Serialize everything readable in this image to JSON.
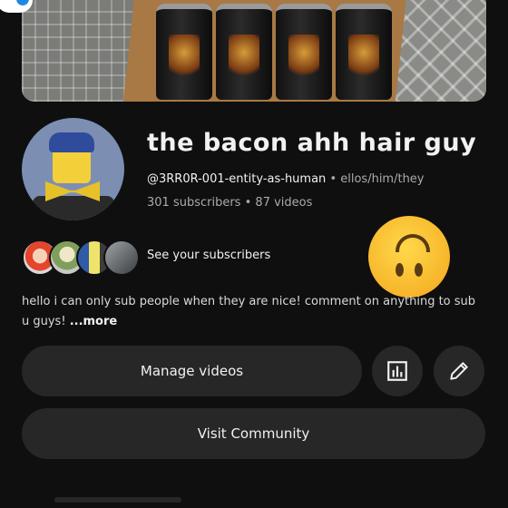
{
  "channel": {
    "name": "the bacon ahh hair guy",
    "handle": "@3RR0R-001-entity-as-human",
    "pronouns": "ellos/him/they",
    "separator": "•",
    "subscribers": "301 subscribers",
    "videos": "87 videos"
  },
  "subscribers_row": {
    "label": "See your subscribers"
  },
  "description": {
    "text": "hello i can only sub people when they are nice! comment on anything to sub u guys! ",
    "more": "...more"
  },
  "actions": {
    "manage_videos": "Manage videos",
    "visit_community": "Visit Community",
    "stats_icon": "bar-chart-icon",
    "edit_icon": "pencil-icon"
  },
  "emoji": "upside-down-face",
  "colors": {
    "background": "#0f0f0f",
    "button": "#272727",
    "secondary_text": "#aaaaaa"
  }
}
